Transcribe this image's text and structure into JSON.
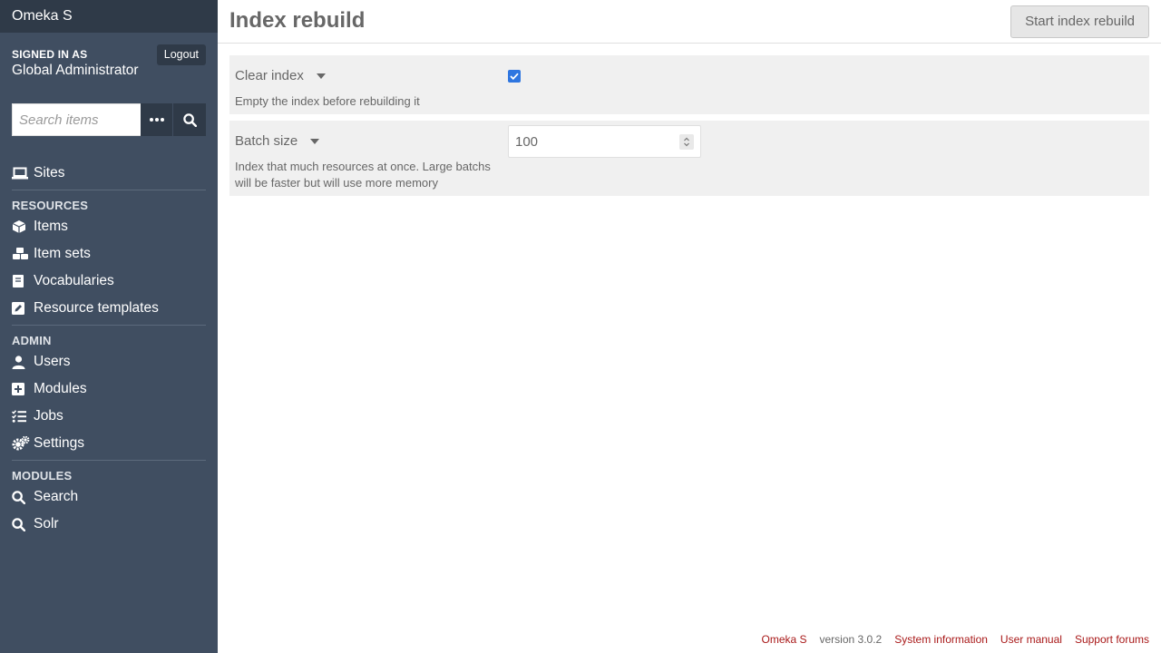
{
  "app": {
    "brand": "Omeka S"
  },
  "user": {
    "signed_in_label": "SIGNED IN AS",
    "role": "Global Administrator",
    "logout_label": "Logout"
  },
  "search": {
    "placeholder": "Search items",
    "options_icon": "ellipsis-icon",
    "submit_icon": "search-icon"
  },
  "nav": {
    "sites": {
      "label": "Sites",
      "icon": "laptop-icon"
    },
    "resources_heading": "RESOURCES",
    "resources": [
      {
        "label": "Items",
        "icon": "cube-icon"
      },
      {
        "label": "Item sets",
        "icon": "cubes-icon"
      },
      {
        "label": "Vocabularies",
        "icon": "book-icon"
      },
      {
        "label": "Resource templates",
        "icon": "edit-icon"
      }
    ],
    "admin_heading": "ADMIN",
    "admin": [
      {
        "label": "Users",
        "icon": "user-icon"
      },
      {
        "label": "Modules",
        "icon": "plus-square-icon"
      },
      {
        "label": "Jobs",
        "icon": "tasks-icon"
      },
      {
        "label": "Settings",
        "icon": "cogs-icon"
      }
    ],
    "modules_heading": "MODULES",
    "modules": [
      {
        "label": "Search",
        "icon": "search-icon"
      },
      {
        "label": "Solr",
        "icon": "search-icon"
      }
    ]
  },
  "page": {
    "title": "Index rebuild",
    "start_button": "Start index rebuild"
  },
  "form": {
    "clear_index": {
      "label": "Clear index",
      "description": "Empty the index before rebuilding it",
      "checked": true
    },
    "batch_size": {
      "label": "Batch size",
      "description": "Index that much resources at once. Large batchs will be faster but will use more memory",
      "value": "100"
    }
  },
  "footer": {
    "brand_link": "Omeka S",
    "version": "version 3.0.2",
    "system_info": "System information",
    "user_manual": "User manual",
    "support_forums": "Support forums"
  },
  "colors": {
    "sidebar": "#404e61",
    "sidebar_dark": "#2f3a48",
    "link": "#a91919",
    "checkbox": "#2f76e0"
  }
}
